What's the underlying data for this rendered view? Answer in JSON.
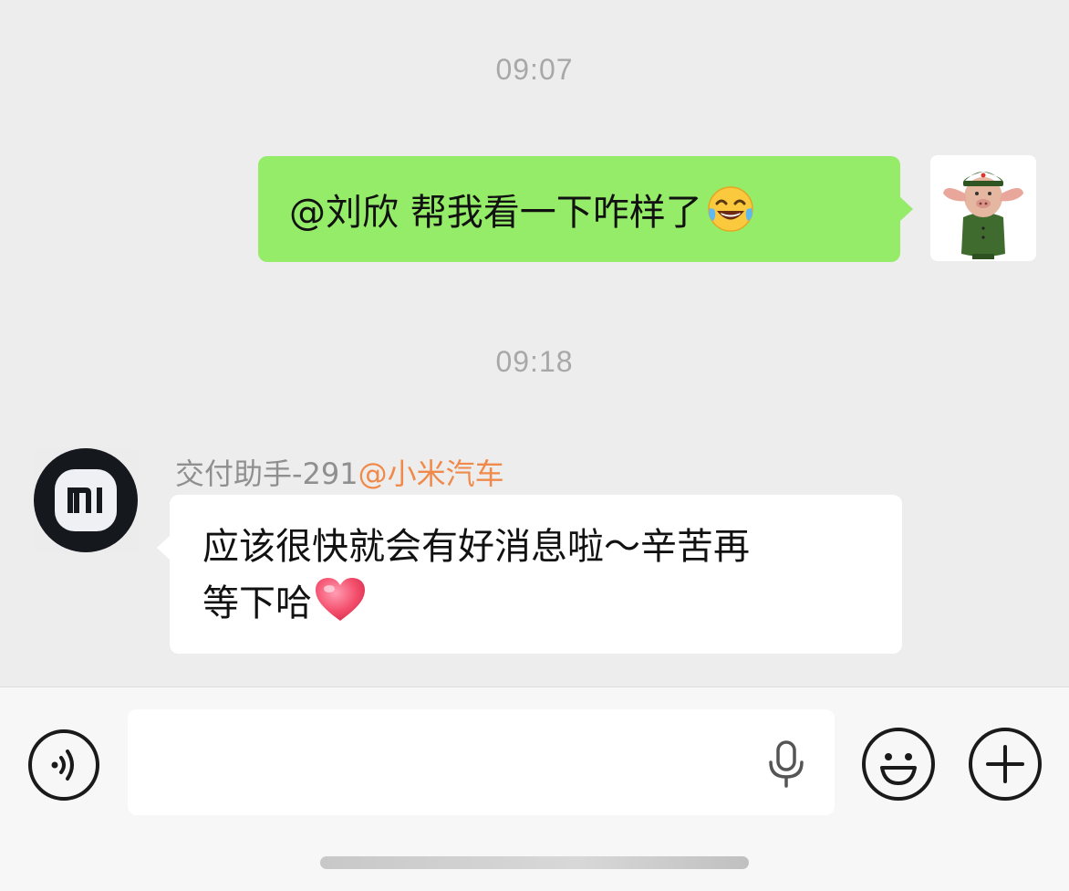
{
  "messages": {
    "timestamp_1": "09:07",
    "outgoing": {
      "text": "@刘欣  帮我看一下咋样了",
      "emoji": "face-with-tears-of-joy-icon"
    },
    "timestamp_2": "09:18",
    "incoming": {
      "sender_name": "交付助手-291",
      "sender_org": "@小米汽车",
      "line1": "应该很快就会有好消息啦～辛苦再",
      "line2": "等下哈",
      "emoji": "heart-icon"
    }
  },
  "input_bar": {
    "value": "",
    "placeholder": "",
    "icons": [
      "voice-mode-icon",
      "microphone-icon",
      "emoji-icon",
      "plus-icon"
    ]
  },
  "colors": {
    "chat_background": "#ededed",
    "outgoing_bubble": "#95ec69",
    "incoming_bubble": "#ffffff",
    "org_name": "#f08a4b"
  }
}
